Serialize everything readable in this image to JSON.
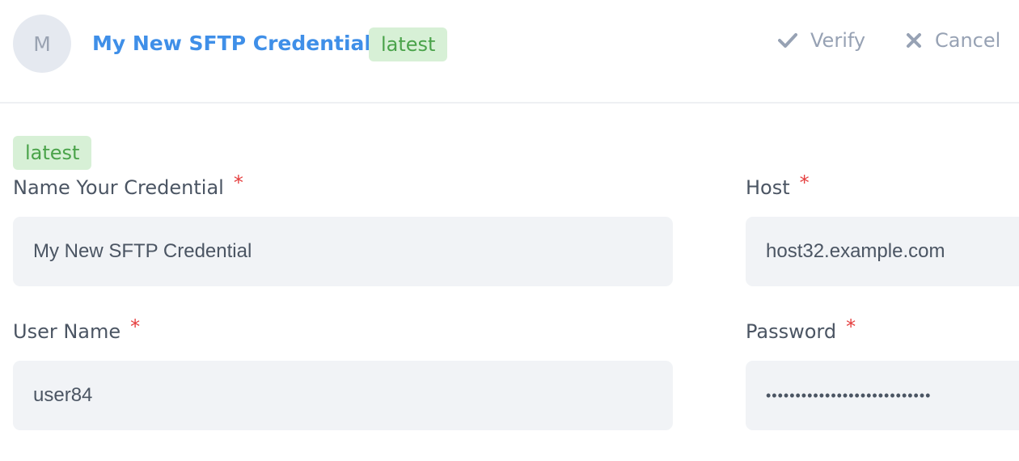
{
  "header": {
    "avatar_initial": "M",
    "title": "My New SFTP Credential",
    "badge": "latest",
    "verify_label": "Verify",
    "cancel_label": "Cancel"
  },
  "form": {
    "badge": "latest",
    "required_mark": "*",
    "name": {
      "label": "Name Your Credential",
      "value": "My New SFTP Credential"
    },
    "host": {
      "label": "Host",
      "value": "host32.example.com"
    },
    "username": {
      "label": "User Name",
      "value": "user84"
    },
    "password": {
      "label": "Password",
      "value": "••••••••••••••••••••••••••••"
    }
  },
  "colors": {
    "title": "#3f8fe8",
    "badge_bg": "#d7f0d6",
    "badge_text": "#4aa34a",
    "required": "#e53e3e",
    "field_bg": "#f1f3f6",
    "action": "#97a2b4"
  }
}
